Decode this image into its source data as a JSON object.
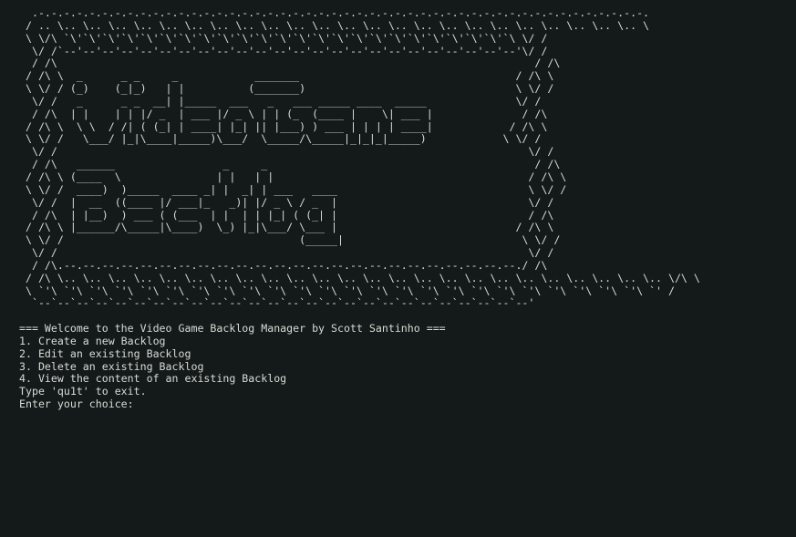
{
  "terminal": {
    "banner_lines": [
      "  .-.-.-.-.-.-.-.-.-.-.-.-.-.-.-.-.-.-.-.-.-.-.-.-.-.-.-.-.-.-.-.-.-.-.-.-.-.-.-.-.-.-.-.-.-.-.-.-.",
      " / .. \\.. \\.. \\.. \\.. \\.. \\.. \\.. \\.. \\.. \\.. \\.. \\.. \\.. \\.. \\.. \\.. \\.. \\.. \\.. \\.. \\.. \\.. \\.. \\",
      " \\ \\/\\ `\\'`\\'`\\'`\\'`\\'`\\'`\\'`\\'`\\'`\\'`\\'`\\'`\\'`\\'`\\'`\\'`\\'`\\'`\\'`\\'`\\'`\\'`\\'`\\ \\/ /",
      "  \\/ /`--'--'--'--'--'--'--'--'--'--'--'--'--'--'--'--'--'--'--'--'--'--'--'--'\\/ /",
      "  / /\\                                                                           / /\\",
      " / /\\ \\  _      _ _     _            _______                                  / /\\ \\",
      " \\ \\/ / (_)    (_|_)   | |          (_______)                                 \\ \\/ /",
      "  \\/ /   _      _ _  __| |_____  ___   _   ___ _____ ____  _____              \\/ /",
      "  / /\\  | |    | | |/ _  | ___ |/ _ \\ | | (_  (____ |    \\| ___ |              / /\\",
      " / /\\ \\  \\ \\  / /| ( (_| | ____| |_| || |___) ) ___ | | | | ____|            / /\\ \\",
      " \\ \\/ /   \\___/ |_|\\____|_____)\\___/  \\_____/\\_____|_|_|_|_____)            \\ \\/ /",
      "  \\/ /                                                                          \\/ /",
      "  / /\\   ______                 _     _                                          / /\\",
      " / /\\ \\ (____  \\               | |   | |                                        / /\\ \\",
      " \\ \\/ /  ____)  )_____  ____ _| |  _| | ___   ____                              \\ \\/ /",
      "  \\/ /  |  __  ((____ |/ ___|_   _)| |/ _ \\ / _  |                              \\/ /",
      "  / /\\  | |__)  ) ___ ( (___  | |  | | |_| ( (_| |                              / /\\",
      " / /\\ \\ |______/\\_____|\\____)  \\_) |_|\\___/ \\___ |                            / /\\ \\",
      " \\ \\/ /                                     (_____|                            \\ \\/ /",
      "  \\/ /                                                                          \\/ /",
      "  / /\\.--.--.--.--.--.--.--.--.--.--.--.--.--.--.--.--.--.--.--.--.--.--.--.--./ /\\",
      " / /\\ \\.. \\.. \\.. \\.. \\.. \\.. \\.. \\.. \\.. \\.. \\.. \\.. \\.. \\.. \\.. \\.. \\.. \\.. \\.. \\.. \\.. \\.. \\.. \\.. \\/\\ \\",
      " \\ `'\\ `'\\ `'\\ `'\\ `'\\ `'\\ `'\\ `'\\ `'\\ `'\\ `'\\ `'\\ `'\\ `'\\ `'\\ `'\\ `'\\ `'\\ `'\\ `'\\ `'\\ `'\\ `'\\ `'\\ `' /",
      "  `--`--`--`--`--`--`--`--`--`--`--`--`--`--`--`--`--`--`--`--`--`--`--`--`--`--'"
    ],
    "welcome": "=== Welcome to the Video Game Backlog Manager by Scott Santinho ===",
    "menu": [
      "1. Create a new Backlog",
      "2. Edit an existing Backlog",
      "3. Delete an existing Backlog",
      "4. View the content of an existing Backlog"
    ],
    "exit_hint": "Type 'qu1t' to exit.",
    "prompt": "Enter your choice:"
  },
  "colors": {
    "background": "#131a19",
    "foreground": "#dadbd6"
  }
}
